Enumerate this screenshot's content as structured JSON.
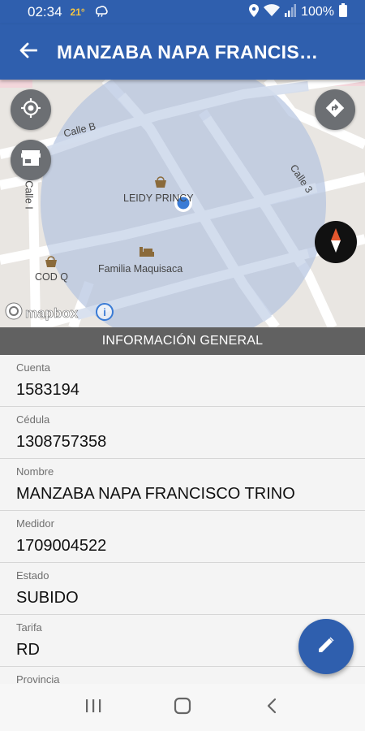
{
  "status_bar": {
    "time": "02:34",
    "temperature": "21°",
    "battery_percent": "100%",
    "icons": [
      "weather-icon",
      "location-icon",
      "wifi-icon",
      "signal-icon",
      "battery-icon"
    ]
  },
  "app_bar": {
    "title": "MANZABA NAPA FRANCISCO TRINO",
    "back_icon": "arrow-back-icon"
  },
  "map": {
    "streets": [
      "Calle B",
      "Calle 3",
      "Calle I"
    ],
    "places": [
      "LEIDY PRINCY",
      "Familia Maquisaca",
      "COD Q"
    ],
    "attribution": "mapbox",
    "info_label": "i",
    "buttons": [
      "my-location-icon",
      "store-icon",
      "directions-icon",
      "compass-icon"
    ]
  },
  "section": {
    "title": "INFORMACIÓN GENERAL"
  },
  "fields": [
    {
      "label": "Cuenta",
      "value": "1583194"
    },
    {
      "label": "Cédula",
      "value": "1308757358"
    },
    {
      "label": "Nombre",
      "value": "MANZABA NAPA FRANCISCO TRINO"
    },
    {
      "label": "Medidor",
      "value": "1709004522"
    },
    {
      "label": "Estado",
      "value": "SUBIDO"
    },
    {
      "label": "Tarifa",
      "value": "RD"
    },
    {
      "label": "Provincia",
      "value": ""
    }
  ],
  "fab": {
    "icon": "edit-pencil-icon"
  },
  "nav_bar": {
    "buttons": [
      "recent-apps-icon",
      "home-icon",
      "back-icon"
    ]
  },
  "colors": {
    "primary": "#2f5fae",
    "section_header": "#616161",
    "accuracy_circle": "#b4c3df",
    "location_dot": "#3a7bd5"
  }
}
